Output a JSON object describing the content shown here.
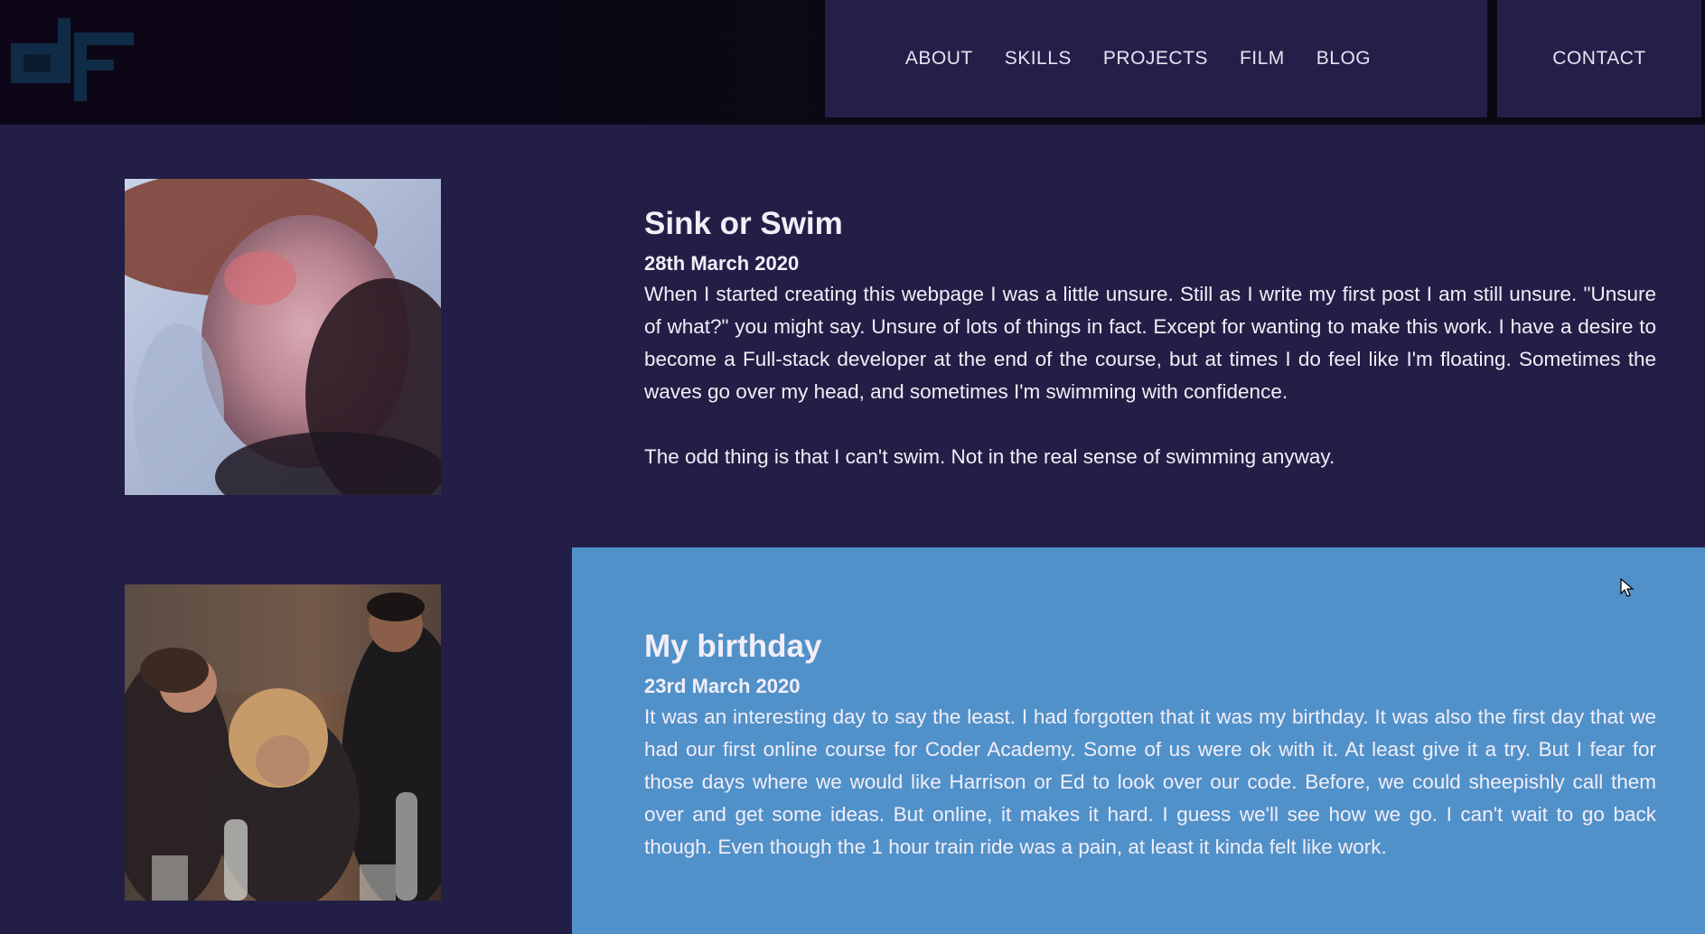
{
  "header": {
    "logo_text": "dF",
    "nav": [
      {
        "label": "ABOUT"
      },
      {
        "label": "SKILLS"
      },
      {
        "label": "PROJECTS"
      },
      {
        "label": "FILM"
      },
      {
        "label": "BLOG"
      }
    ],
    "contact_label": "CONTACT"
  },
  "posts": [
    {
      "title": "Sink or Swim",
      "date": "28th March 2020",
      "paragraphs": [
        "When I started creating this webpage I was a little unsure. Still as I write my first post I am still unsure. \"Unsure of what?\" you might say. Unsure of lots of things in fact. Except for wanting to make this work. I have a desire to become a Full-stack developer at the end of the course, but at times I do feel like I'm floating. Sometimes the waves go over my head, and sometimes I'm swimming with confidence.",
        "The odd thing is that I can't swim. Not in the real sense of swimming anyway."
      ]
    },
    {
      "title": "My birthday",
      "date": "23rd March 2020",
      "paragraphs": [
        "It was an interesting day to say the least. I had forgotten that it was my birthday. It was also the first day that we had our first online course for Coder Academy. Some of us were ok with it. At least give it a try. But I fear for those days where we would like Harrison or Ed to look over our code. Before, we could sheepishly call them over and get some ideas. But online, it makes it hard. I guess we'll see how we go. I can't wait to go back though. Even though the 1 hour train ride was a pain, at least it kinda felt like work."
      ]
    }
  ],
  "colors": {
    "page_bg": "#231e45",
    "nav_bg": "#241f48",
    "header_bg": "#0b0813",
    "highlight_post_bg": "#5191c9",
    "text": "#f2eef8"
  }
}
